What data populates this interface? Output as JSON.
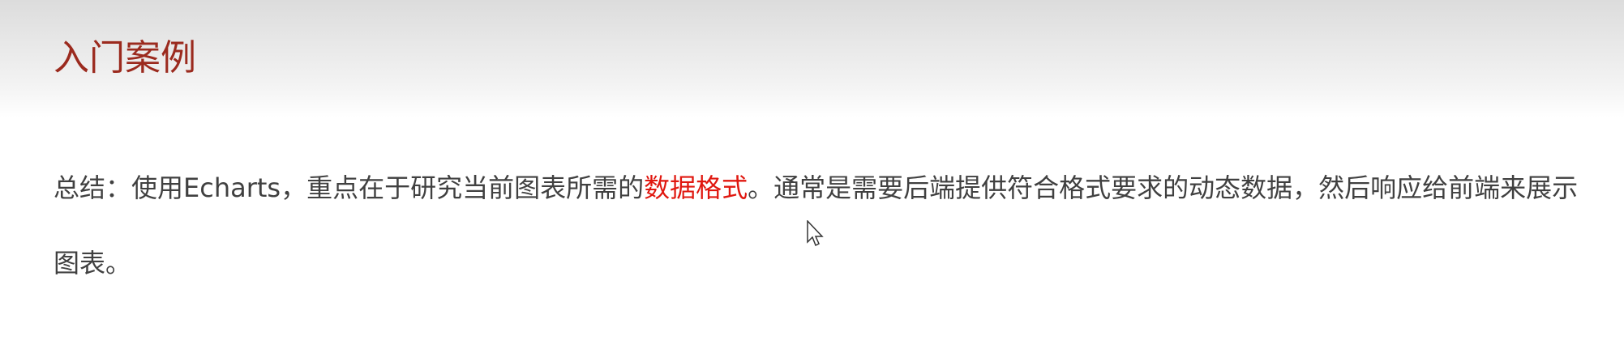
{
  "slide": {
    "title": "入门案例",
    "summary_prefix": "总结：使用Echarts，重点在于研究当前图表所需的",
    "summary_highlight": "数据格式",
    "summary_suffix": "。通常是需要后端提供符合格式要求的动态数据，然后响应给前端来展示图表。",
    "highlight_color": "#e0170f",
    "title_color": "#9b2a1e"
  }
}
